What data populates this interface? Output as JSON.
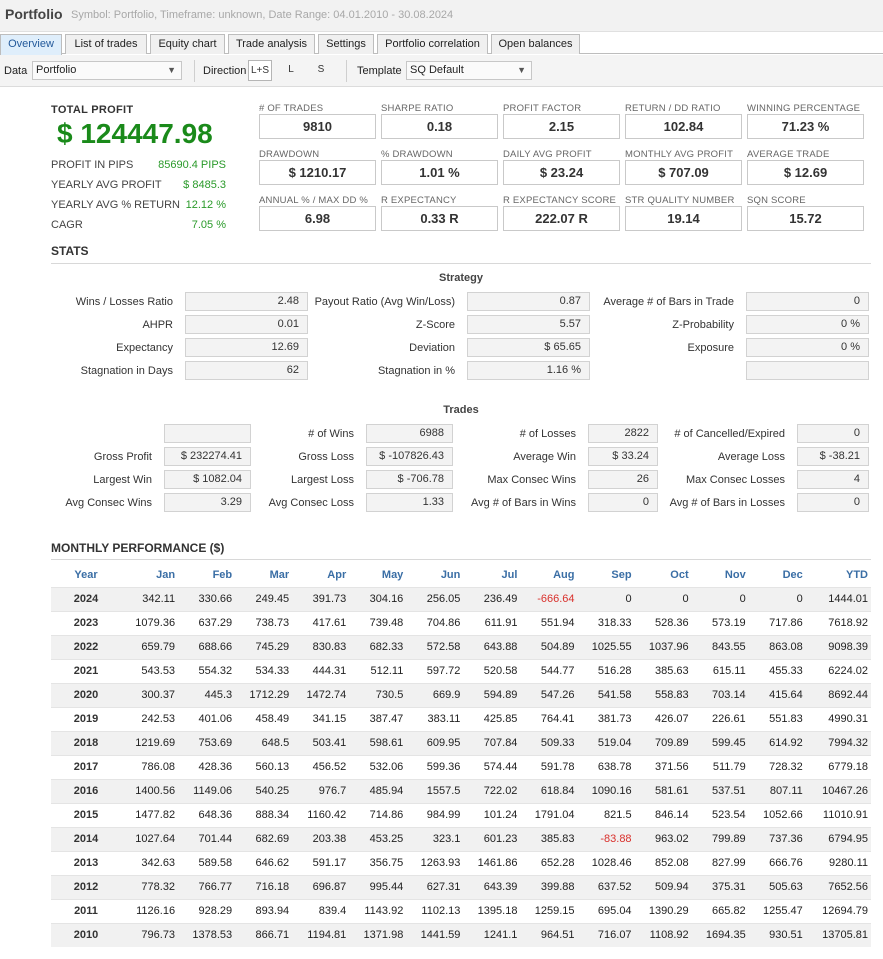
{
  "header": {
    "title": "Portfolio",
    "subtitle": "Symbol: Portfolio, Timeframe: unknown, Date Range: 04.01.2010 - 30.08.2024"
  },
  "tabs": [
    "Overview",
    "List of trades",
    "Equity chart",
    "Trade analysis",
    "Settings",
    "Portfolio correlation",
    "Open balances"
  ],
  "toolbar": {
    "data_label": "Data",
    "data_value": "Portfolio",
    "direction_label": "Direction",
    "directions": [
      "L+S",
      "L",
      "S"
    ],
    "template_label": "Template",
    "template_value": "SQ Default",
    "dropdown_glyph": "▼"
  },
  "summary": {
    "total_profit_label": "TOTAL PROFIT",
    "total_profit": "$ 124447.98",
    "rows": [
      {
        "label": "PROFIT IN PIPS",
        "value": "85690.4 PIPS"
      },
      {
        "label": "YEARLY AVG PROFIT",
        "value": "$ 8485.3"
      },
      {
        "label": "YEARLY AVG % RETURN",
        "value": "12.12 %"
      },
      {
        "label": "CAGR",
        "value": "7.05 %"
      }
    ]
  },
  "metrics": [
    {
      "label": "# OF TRADES",
      "value": "9810"
    },
    {
      "label": "SHARPE RATIO",
      "value": "0.18"
    },
    {
      "label": "PROFIT FACTOR",
      "value": "2.15"
    },
    {
      "label": "RETURN / DD RATIO",
      "value": "102.84"
    },
    {
      "label": "WINNING PERCENTAGE",
      "value": "71.23 %"
    },
    {
      "label": "DRAWDOWN",
      "value": "$ 1210.17"
    },
    {
      "label": "% DRAWDOWN",
      "value": "1.01 %"
    },
    {
      "label": "DAILY AVG PROFIT",
      "value": "$ 23.24"
    },
    {
      "label": "MONTHLY AVG PROFIT",
      "value": "$ 707.09"
    },
    {
      "label": "AVERAGE TRADE",
      "value": "$ 12.69"
    },
    {
      "label": "ANNUAL % / MAX DD %",
      "value": "6.98"
    },
    {
      "label": "R EXPECTANCY",
      "value": "0.33 R"
    },
    {
      "label": "R EXPECTANCY SCORE",
      "value": "222.07 R"
    },
    {
      "label": "STR QUALITY NUMBER",
      "value": "19.14"
    },
    {
      "label": "SQN SCORE",
      "value": "15.72"
    }
  ],
  "stats": {
    "title": "STATS",
    "strategy_title": "Strategy",
    "strategy": [
      {
        "label": "Wins / Losses Ratio",
        "value": "2.48"
      },
      {
        "label": "Payout Ratio (Avg Win/Loss)",
        "value": "0.87"
      },
      {
        "label": "Average # of Bars in Trade",
        "value": "0"
      },
      {
        "label": "AHPR",
        "value": "0.01"
      },
      {
        "label": "Z-Score",
        "value": "5.57"
      },
      {
        "label": "Z-Probability",
        "value": "0 %"
      },
      {
        "label": "Expectancy",
        "value": "12.69"
      },
      {
        "label": "Deviation",
        "value": "$ 65.65"
      },
      {
        "label": "Exposure",
        "value": "0 %"
      },
      {
        "label": "Stagnation in Days",
        "value": "62"
      },
      {
        "label": "Stagnation in %",
        "value": "1.16 %"
      },
      {
        "label": "",
        "value": ""
      }
    ],
    "trades_title": "Trades",
    "trades": [
      {
        "label": "",
        "value": ""
      },
      {
        "label": "# of Wins",
        "value": "6988"
      },
      {
        "label": "# of Losses",
        "value": "2822"
      },
      {
        "label": "# of Cancelled/Expired",
        "value": "0"
      },
      {
        "label": "Gross Profit",
        "value": "$ 232274.41"
      },
      {
        "label": "Gross Loss",
        "value": "$ -107826.43"
      },
      {
        "label": "Average Win",
        "value": "$ 33.24"
      },
      {
        "label": "Average Loss",
        "value": "$ -38.21"
      },
      {
        "label": "Largest Win",
        "value": "$ 1082.04"
      },
      {
        "label": "Largest Loss",
        "value": "$ -706.78"
      },
      {
        "label": "Max Consec Wins",
        "value": "26"
      },
      {
        "label": "Max Consec Losses",
        "value": "4"
      },
      {
        "label": "Avg Consec Wins",
        "value": "3.29"
      },
      {
        "label": "Avg Consec Loss",
        "value": "1.33"
      },
      {
        "label": "Avg # of Bars in Wins",
        "value": "0"
      },
      {
        "label": "Avg # of Bars in Losses",
        "value": "0"
      }
    ]
  },
  "monthly": {
    "title": "MONTHLY PERFORMANCE ($)",
    "headers": [
      "Year",
      "Jan",
      "Feb",
      "Mar",
      "Apr",
      "May",
      "Jun",
      "Jul",
      "Aug",
      "Sep",
      "Oct",
      "Nov",
      "Dec",
      "YTD"
    ],
    "rows": [
      [
        "2024",
        "342.11",
        "330.66",
        "249.45",
        "391.73",
        "304.16",
        "256.05",
        "236.49",
        "-666.64",
        "0",
        "0",
        "0",
        "0",
        "1444.01"
      ],
      [
        "2023",
        "1079.36",
        "637.29",
        "738.73",
        "417.61",
        "739.48",
        "704.86",
        "611.91",
        "551.94",
        "318.33",
        "528.36",
        "573.19",
        "717.86",
        "7618.92"
      ],
      [
        "2022",
        "659.79",
        "688.66",
        "745.29",
        "830.83",
        "682.33",
        "572.58",
        "643.88",
        "504.89",
        "1025.55",
        "1037.96",
        "843.55",
        "863.08",
        "9098.39"
      ],
      [
        "2021",
        "543.53",
        "554.32",
        "534.33",
        "444.31",
        "512.11",
        "597.72",
        "520.58",
        "544.77",
        "516.28",
        "385.63",
        "615.11",
        "455.33",
        "6224.02"
      ],
      [
        "2020",
        "300.37",
        "445.3",
        "1712.29",
        "1472.74",
        "730.5",
        "669.9",
        "594.89",
        "547.26",
        "541.58",
        "558.83",
        "703.14",
        "415.64",
        "8692.44"
      ],
      [
        "2019",
        "242.53",
        "401.06",
        "458.49",
        "341.15",
        "387.47",
        "383.11",
        "425.85",
        "764.41",
        "381.73",
        "426.07",
        "226.61",
        "551.83",
        "4990.31"
      ],
      [
        "2018",
        "1219.69",
        "753.69",
        "648.5",
        "503.41",
        "598.61",
        "609.95",
        "707.84",
        "509.33",
        "519.04",
        "709.89",
        "599.45",
        "614.92",
        "7994.32"
      ],
      [
        "2017",
        "786.08",
        "428.36",
        "560.13",
        "456.52",
        "532.06",
        "599.36",
        "574.44",
        "591.78",
        "638.78",
        "371.56",
        "511.79",
        "728.32",
        "6779.18"
      ],
      [
        "2016",
        "1400.56",
        "1149.06",
        "540.25",
        "976.7",
        "485.94",
        "1557.5",
        "722.02",
        "618.84",
        "1090.16",
        "581.61",
        "537.51",
        "807.11",
        "10467.26"
      ],
      [
        "2015",
        "1477.82",
        "648.36",
        "888.34",
        "1160.42",
        "714.86",
        "984.99",
        "101.24",
        "1791.04",
        "821.5",
        "846.14",
        "523.54",
        "1052.66",
        "11010.91"
      ],
      [
        "2014",
        "1027.64",
        "701.44",
        "682.69",
        "203.38",
        "453.25",
        "323.1",
        "601.23",
        "385.83",
        "-83.88",
        "963.02",
        "799.89",
        "737.36",
        "6794.95"
      ],
      [
        "2013",
        "342.63",
        "589.58",
        "646.62",
        "591.17",
        "356.75",
        "1263.93",
        "1461.86",
        "652.28",
        "1028.46",
        "852.08",
        "827.99",
        "666.76",
        "9280.11"
      ],
      [
        "2012",
        "778.32",
        "766.77",
        "716.18",
        "696.87",
        "995.44",
        "627.31",
        "643.39",
        "399.88",
        "637.52",
        "509.94",
        "375.31",
        "505.63",
        "7652.56"
      ],
      [
        "2011",
        "1126.16",
        "928.29",
        "893.94",
        "839.4",
        "1143.92",
        "1102.13",
        "1395.18",
        "1259.15",
        "695.04",
        "1390.29",
        "665.82",
        "1255.47",
        "12694.79"
      ],
      [
        "2010",
        "796.73",
        "1378.53",
        "866.71",
        "1194.81",
        "1371.98",
        "1441.59",
        "1241.1",
        "964.51",
        "716.07",
        "1108.92",
        "1694.35",
        "930.51",
        "13705.81"
      ]
    ]
  }
}
